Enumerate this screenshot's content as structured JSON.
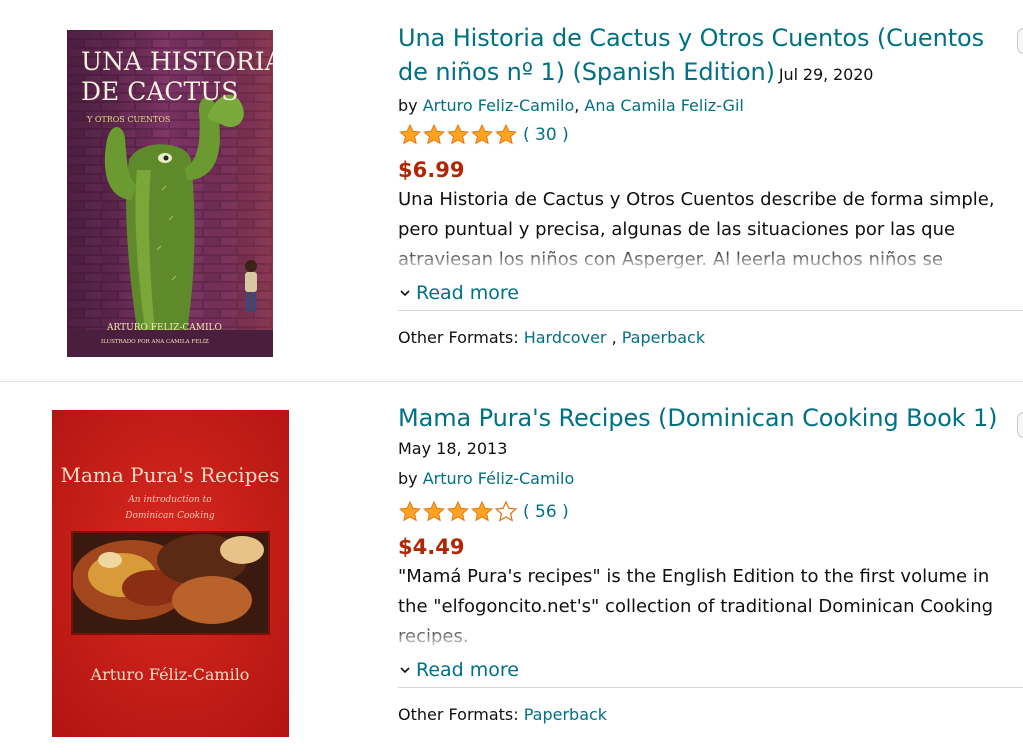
{
  "results": [
    {
      "title": "Una Historia de Cactus y Otros Cuentos (Cuentos de niños nº 1) (Spanish Edition)",
      "date": "Jul 29, 2020",
      "by_label": "by",
      "authors": [
        "Arturo Feliz-Camilo",
        "Ana Camila Feliz-Gil"
      ],
      "author_separator": ", ",
      "rating_stars": 5,
      "rating_count": "( 30 )",
      "price": "$6.99",
      "description": "Una Historia de Cactus y Otros Cuentos describe de forma simple, pero puntual y precisa, algunas de las situaciones por las que atraviesan los niños con Asperger. Al leerla muchos niños se",
      "read_more": "Read more",
      "other_formats_label": "Other Formats:",
      "formats": [
        "Hardcover",
        "Paperback"
      ],
      "format_separator": " , ",
      "cover": {
        "title_line1": "UNA HISTORIA",
        "title_line2": "DE CACTUS",
        "subtitle": "Y OTROS CUENTOS",
        "author": "ARTURO FELIZ-CAMILO",
        "illustrator": "ILUSTRADO POR ANA CAMILA FELIZ"
      }
    },
    {
      "title": "Mama Pura's Recipes (Dominican Cooking Book 1)",
      "date": "May 18, 2013",
      "by_label": "by",
      "authors": [
        "Arturo Féliz-Camilo"
      ],
      "rating_stars": 4,
      "rating_count": "( 56 )",
      "price": "$4.49",
      "description": "\"Mamá Pura's recipes\" is the English Edition to the first volume in the \"elfogoncito.net's\" collection of traditional Dominican Cooking recipes.",
      "read_more": "Read more",
      "other_formats_label": "Other Formats:",
      "formats": [
        "Paperback"
      ],
      "cover": {
        "title": "Mama Pura's Recipes",
        "subtitle_line1": "An introduction to",
        "subtitle_line2": "Dominican Cooking",
        "author": "Arturo Féliz-Camilo"
      }
    }
  ],
  "colors": {
    "link": "#007185",
    "price": "#B12704",
    "star": "#FFA41C",
    "text": "#0F1111"
  },
  "icons": {
    "star": "star-icon",
    "chevron": "chevron-down-icon"
  }
}
